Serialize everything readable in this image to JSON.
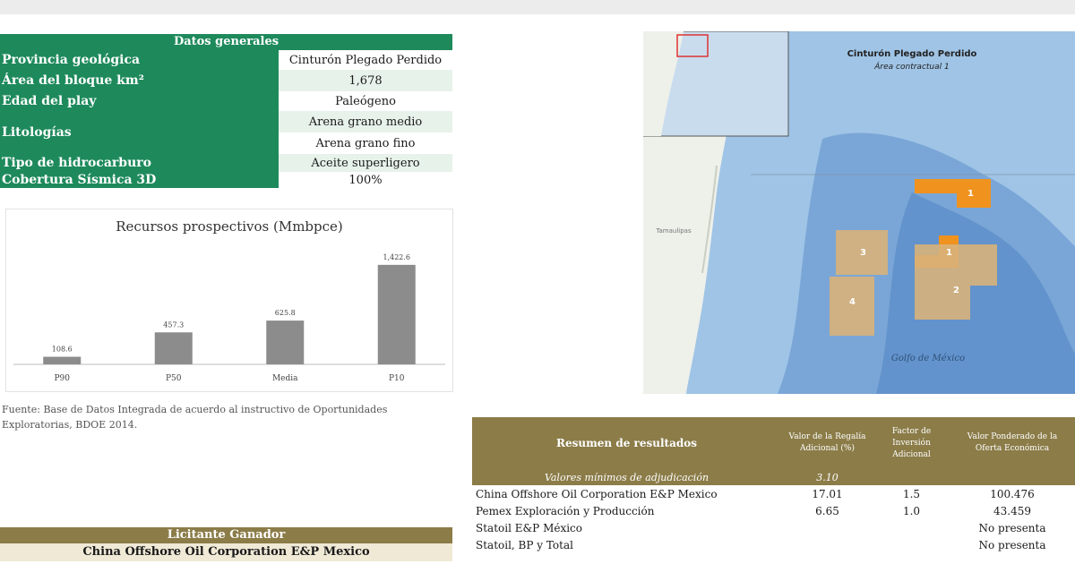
{
  "general": {
    "header": "Datos generales",
    "rows": [
      {
        "label": "Provincia geológica",
        "values": [
          "Cinturón Plegado Perdido"
        ]
      },
      {
        "label": "Área del bloque km²",
        "values": [
          "1,678"
        ]
      },
      {
        "label": "Edad del play",
        "values": [
          "Paleógeno"
        ]
      },
      {
        "label": "Litologías",
        "values": [
          "Arena grano medio",
          "Arena grano fino"
        ]
      },
      {
        "label": "Tipo de hidrocarburo",
        "values": [
          "Aceite superligero"
        ]
      },
      {
        "label": "Cobertura Sísmica 3D",
        "values": [
          "100%"
        ]
      }
    ]
  },
  "chart_data": {
    "type": "bar",
    "title": "Recursos prospectivos (Mmbpce)",
    "categories": [
      "P90",
      "P50",
      "Media",
      "P10"
    ],
    "values": [
      108.6,
      457.3,
      625.8,
      1422.6
    ],
    "value_labels": [
      "108.6",
      "457.3",
      "625.8",
      "1,422.6"
    ],
    "ylim": [
      0,
      1600
    ],
    "bar_color": "#8c8c8c",
    "grid": false
  },
  "source_note": "Fuente: Base de Datos Integrada de acuerdo al instructivo de Oportunidades Exploratorias, BDOE 2014.",
  "winner": {
    "header": "Licitante Ganador",
    "name": "China Offshore Oil Corporation E&P Mexico"
  },
  "map": {
    "title": "Cinturón Plegado Perdido",
    "subtitle": "Área contractual 1",
    "sea_label": "Golfo de México",
    "land_label": "Tamaulipas",
    "block_labels": [
      "1",
      "1",
      "2",
      "3",
      "4"
    ],
    "colors": {
      "sea": "#9fc4e6",
      "deep": "#5d8fc8",
      "land": "#eef0ea",
      "awarded": "#f0921e",
      "blocks": "#d8b27a"
    }
  },
  "results": {
    "title": "Resumen de resultados",
    "col2": "Valor de la Regalía Adicional (%)",
    "col3": "Factor de Inversión Adicional",
    "col4": "Valor Ponderado de la Oferta Económica",
    "min_label": "Valores mínimos de adjudicación",
    "min_value": "3.10",
    "rows": [
      {
        "name": "China Offshore Oil Corporation E&P Mexico",
        "royalty": "17.01",
        "factor": "1.5",
        "value": "100.476"
      },
      {
        "name": "Pemex Exploración y Producción",
        "royalty": "6.65",
        "factor": "1.0",
        "value": "43.459"
      },
      {
        "name": "Statoil E&P México",
        "royalty": "",
        "factor": "",
        "value": "No presenta"
      },
      {
        "name": "Statoil, BP y Total",
        "royalty": "",
        "factor": "",
        "value": "No presenta"
      }
    ]
  },
  "colors": {
    "green": "#1e8a5c",
    "olive": "#8b7c48"
  }
}
